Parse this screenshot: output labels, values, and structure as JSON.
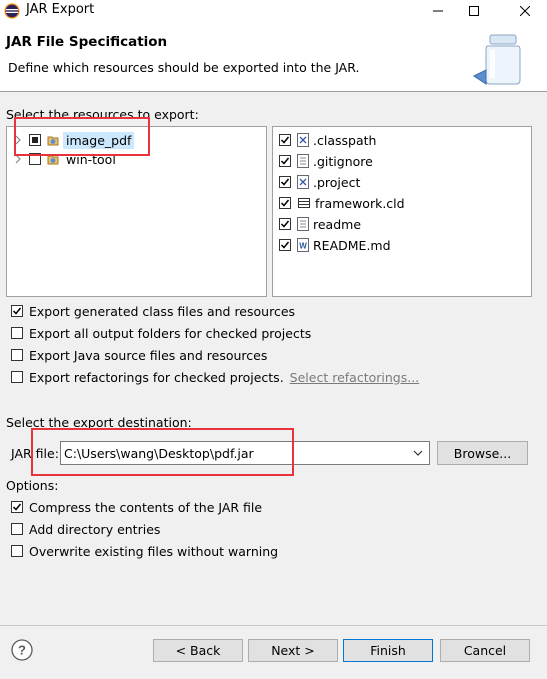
{
  "window": {
    "title": "JAR Export"
  },
  "header": {
    "title": "JAR File Specification",
    "description": "Define which resources should be exported into the JAR."
  },
  "resources": {
    "label": "Select the resources to export:",
    "projects": [
      {
        "label": "image_pdf",
        "state": "partial",
        "selected": true
      },
      {
        "label": "win-tool",
        "state": "unchecked",
        "selected": false
      }
    ],
    "files": [
      {
        "label": ".classpath",
        "checked": true,
        "icon": "xml-file-icon"
      },
      {
        "label": ".gitignore",
        "checked": true,
        "icon": "text-file-icon"
      },
      {
        "label": ".project",
        "checked": true,
        "icon": "xml-file-icon"
      },
      {
        "label": "framework.cld",
        "checked": true,
        "icon": "table-file-icon"
      },
      {
        "label": "readme",
        "checked": true,
        "icon": "text-file-icon"
      },
      {
        "label": "README.md",
        "checked": true,
        "icon": "word-file-icon"
      }
    ]
  },
  "export_options": [
    {
      "label": "Export generated class files and resources",
      "checked": true
    },
    {
      "label": "Export all output folders for checked projects",
      "checked": false
    },
    {
      "label": "Export Java source files and resources",
      "checked": false
    },
    {
      "label": "Export refactorings for checked projects.",
      "checked": false
    }
  ],
  "select_refactorings_link": "Select refactorings...",
  "destination": {
    "label": "Select the export destination:",
    "jar_file_label": "JAR file:",
    "jar_file_value": "C:\\Users\\wang\\Desktop\\pdf.jar",
    "browse_label": "Browse..."
  },
  "options": {
    "label": "Options:",
    "items": [
      {
        "label": "Compress the contents of the JAR file",
        "checked": true
      },
      {
        "label": "Add directory entries",
        "checked": false
      },
      {
        "label": "Overwrite existing files without warning",
        "checked": false
      }
    ]
  },
  "buttons": {
    "back": "< Back",
    "next": "Next >",
    "finish": "Finish",
    "cancel": "Cancel"
  },
  "help_icon": "question-mark-icon",
  "colors": {
    "accent": "#0078d7",
    "highlight_box": "#e8333a",
    "link": "#7a7a7a",
    "selection": "#cce8ff"
  }
}
